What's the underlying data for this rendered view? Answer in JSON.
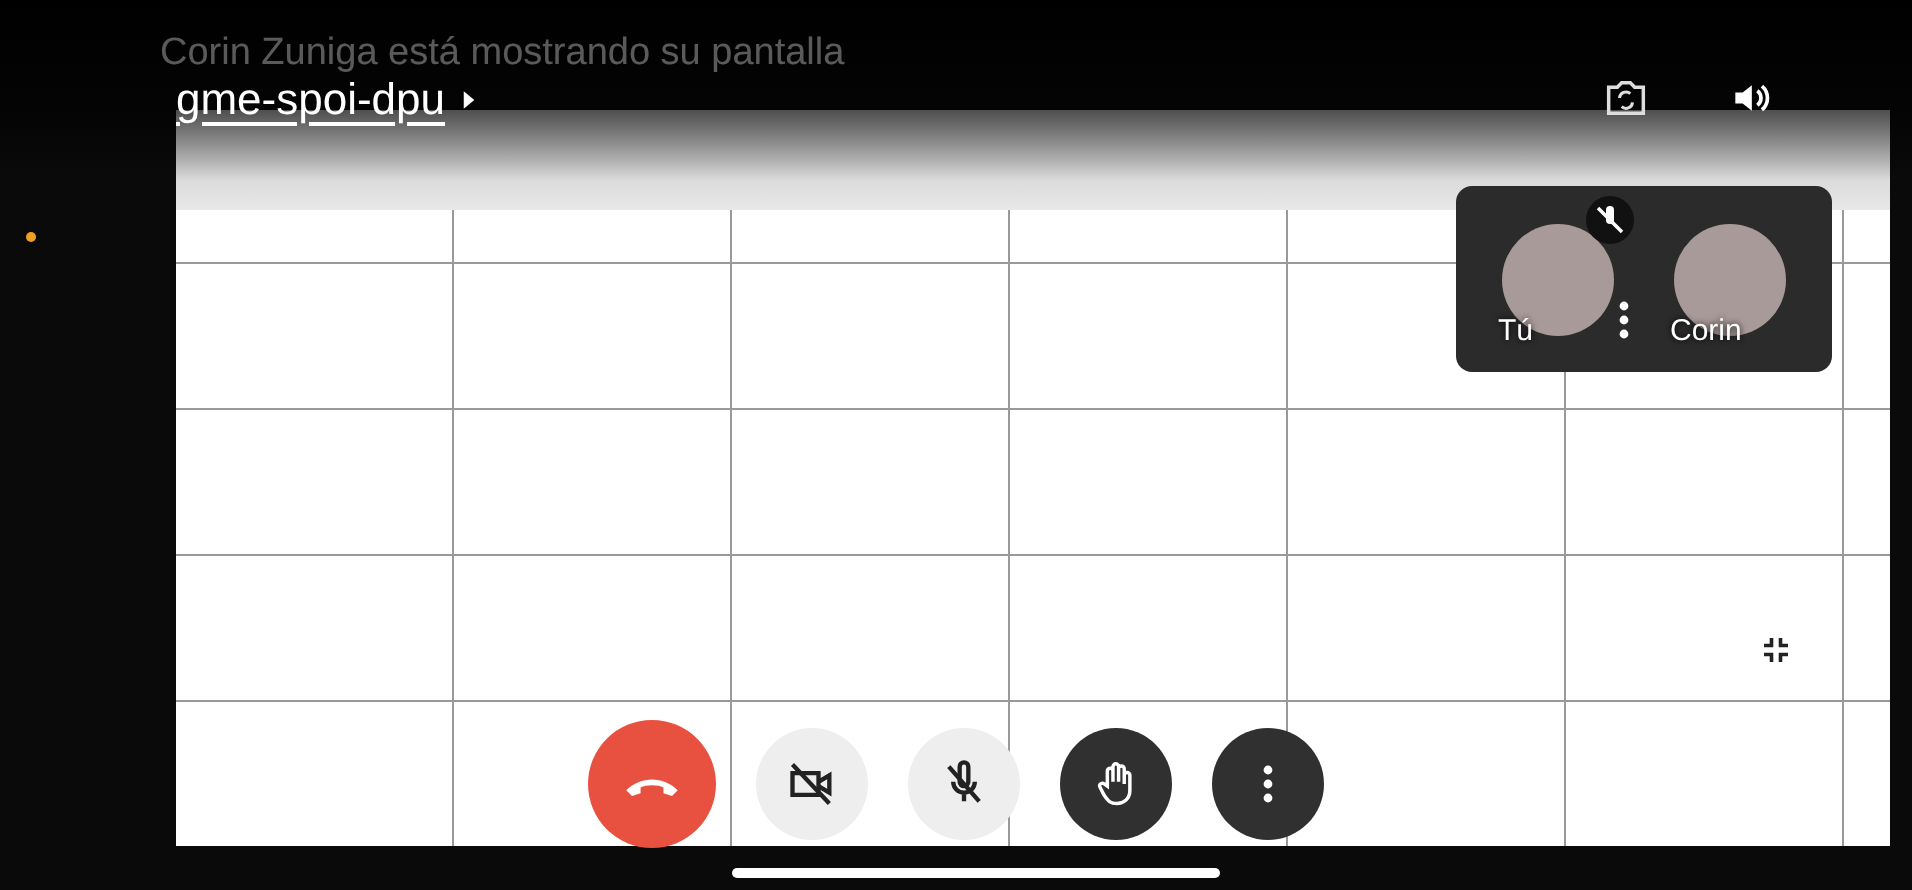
{
  "share_notice": "Corin Zuniga está mostrando su pantalla",
  "meeting_code": "gme-spoi-dpu",
  "participants": [
    {
      "name": "Tú",
      "muted": true,
      "own": true
    },
    {
      "name": "Corin",
      "muted": false,
      "own": false
    }
  ],
  "controls": [
    {
      "kind": "end_call"
    },
    {
      "kind": "camera",
      "on": false
    },
    {
      "kind": "mic",
      "on": false
    },
    {
      "kind": "raise_hand"
    },
    {
      "kind": "more"
    }
  ]
}
